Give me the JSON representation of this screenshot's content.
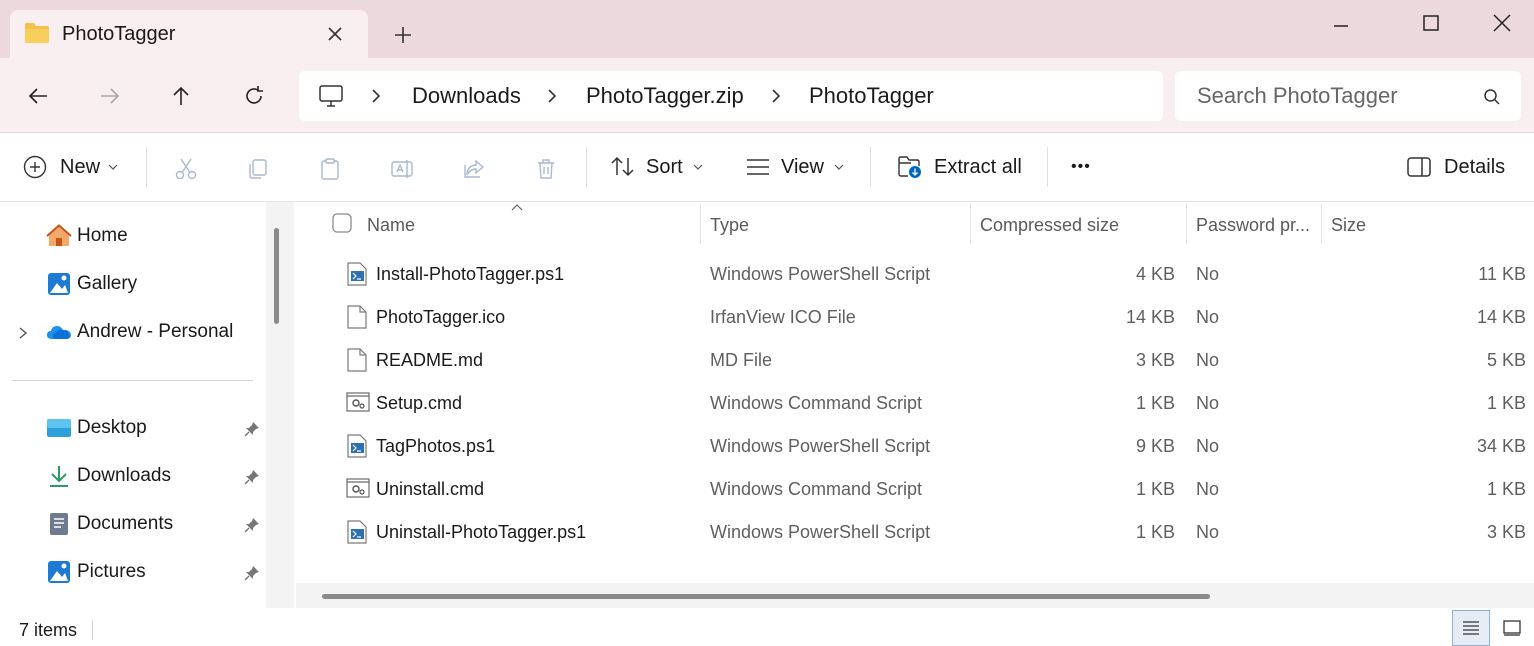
{
  "window": {
    "tab_title": "PhotoTagger",
    "tab_icon": "folder-icon",
    "new_tab_label": "+"
  },
  "nav": {
    "breadcrumbs": [
      "Downloads",
      "PhotoTagger.zip",
      "PhotoTagger"
    ],
    "search_placeholder": "Search PhotoTagger"
  },
  "toolbar": {
    "new_label": "New",
    "sort_label": "Sort",
    "view_label": "View",
    "extract_label": "Extract all",
    "more_label": "•••",
    "details_label": "Details"
  },
  "sidebar": {
    "top_items": [
      {
        "label": "Home",
        "icon": "home-icon"
      },
      {
        "label": "Gallery",
        "icon": "gallery-icon"
      },
      {
        "label": "Andrew - Personal",
        "icon": "onedrive-icon"
      }
    ],
    "pinned_items": [
      {
        "label": "Desktop",
        "icon": "desktop-icon"
      },
      {
        "label": "Downloads",
        "icon": "download-icon"
      },
      {
        "label": "Documents",
        "icon": "documents-icon"
      },
      {
        "label": "Pictures",
        "icon": "pictures-icon"
      }
    ]
  },
  "columns": {
    "name": "Name",
    "type": "Type",
    "compressed": "Compressed size",
    "password": "Password pr...",
    "size": "Size"
  },
  "files": [
    {
      "name": "Install-PhotoTagger.ps1",
      "type": "Windows PowerShell Script",
      "compressed": "4 KB",
      "password": "No",
      "size": "11 KB",
      "icon": "powershell-script-icon"
    },
    {
      "name": "PhotoTagger.ico",
      "type": "IrfanView ICO File",
      "compressed": "14 KB",
      "password": "No",
      "size": "14 KB",
      "icon": "blank-file-icon"
    },
    {
      "name": "README.md",
      "type": "MD File",
      "compressed": "3 KB",
      "password": "No",
      "size": "5 KB",
      "icon": "blank-file-icon"
    },
    {
      "name": "Setup.cmd",
      "type": "Windows Command Script",
      "compressed": "1 KB",
      "password": "No",
      "size": "1 KB",
      "icon": "cmd-script-icon"
    },
    {
      "name": "TagPhotos.ps1",
      "type": "Windows PowerShell Script",
      "compressed": "9 KB",
      "password": "No",
      "size": "34 KB",
      "icon": "powershell-script-icon"
    },
    {
      "name": "Uninstall.cmd",
      "type": "Windows Command Script",
      "compressed": "1 KB",
      "password": "No",
      "size": "1 KB",
      "icon": "cmd-script-icon"
    },
    {
      "name": "Uninstall-PhotoTagger.ps1",
      "type": "Windows PowerShell Script",
      "compressed": "1 KB",
      "password": "No",
      "size": "3 KB",
      "icon": "powershell-script-icon"
    }
  ],
  "status": {
    "item_count": "7 items"
  },
  "colors": {
    "titlebar": "#ecd9dd",
    "navbar": "#f9eef0",
    "accent": "#0067c0"
  }
}
